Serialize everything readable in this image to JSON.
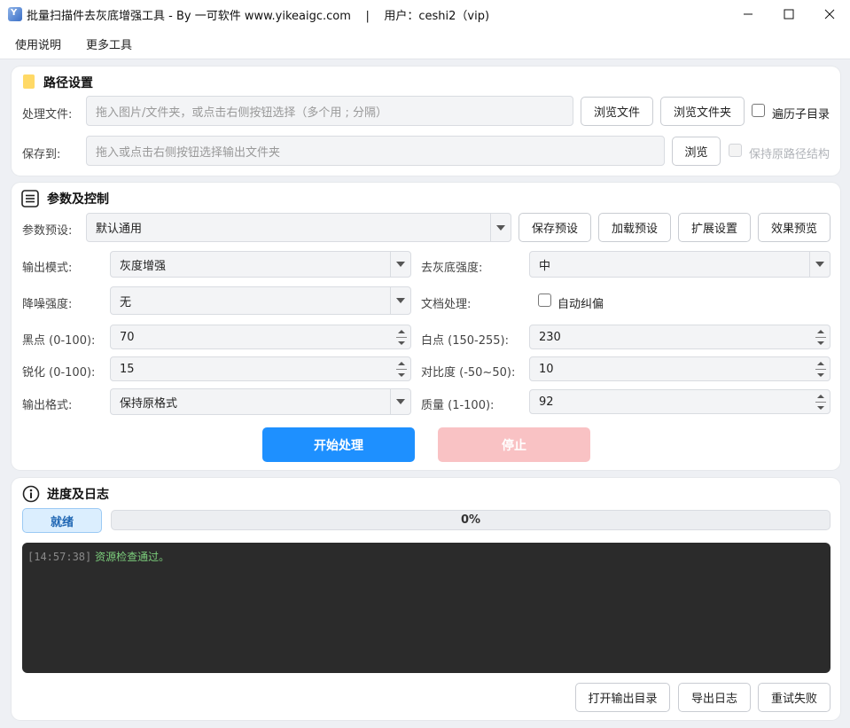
{
  "window": {
    "title": "批量扫描件去灰底增强工具 - By 一可软件 www.yikeaigc.com    |    用户：ceshi2（vip)",
    "icon_letter": "Y",
    "controls": {
      "minimize": "—",
      "maximize": "☐",
      "close": "✕"
    }
  },
  "menu": {
    "items": [
      "使用说明",
      "更多工具"
    ]
  },
  "path_settings": {
    "title": "路径设置",
    "input_label": "处理文件:",
    "input_placeholder": "拖入图片/文件夹，或点击右侧按钮选择（多个用 ; 分隔）",
    "browse_files": "浏览文件",
    "browse_folder": "浏览文件夹",
    "recurse_label": "遍历子目录",
    "recurse_checked": false,
    "save_label": "保存到:",
    "save_placeholder": "拖入或点击右侧按钮选择输出文件夹",
    "browse_save": "浏览",
    "keep_structure_label": "保持原路径结构",
    "keep_structure_checked": false,
    "keep_structure_enabled": false
  },
  "params": {
    "title": "参数及控制",
    "preset_label": "参数预设:",
    "preset_value": "默认通用",
    "save_preset": "保存预设",
    "load_preset": "加载预设",
    "extended_settings": "扩展设置",
    "preview": "效果预览",
    "output_mode_label": "输出模式:",
    "output_mode_value": "灰度增强",
    "degray_label": "去灰底强度:",
    "degray_value": "中",
    "denoise_label": "降噪强度:",
    "denoise_value": "无",
    "doc_label": "文档处理:",
    "auto_deskew_label": "自动纠偏",
    "auto_deskew_checked": false,
    "black_label": "黑点 (0-100):",
    "black_value": "70",
    "white_label": "白点 (150-255):",
    "white_value": "230",
    "sharpen_label": "锐化 (0-100):",
    "sharpen_value": "15",
    "contrast_label": "对比度 (-50~50):",
    "contrast_value": "10",
    "format_label": "输出格式:",
    "format_value": "保持原格式",
    "quality_label": "质量 (1-100):",
    "quality_value": "92",
    "start_button": "开始处理",
    "stop_button": "停止"
  },
  "progress": {
    "title": "进度及日志",
    "status": "就绪",
    "percent_text": "0%",
    "progress_fraction": 0.0,
    "log": [
      {
        "time": "[14:57:38]",
        "message": "资源检查通过。"
      }
    ],
    "open_output": "打开输出目录",
    "export_log": "导出日志",
    "retry_failed": "重试失败"
  },
  "colors": {
    "primary": "#1e90ff",
    "stop_disabled": "#f9c2c4",
    "status_bg": "#dbeefe",
    "status_text": "#1f66b3",
    "log_bg": "#2b2b2b",
    "log_time": "#8a8a8a",
    "log_ok": "#7ccf7c"
  }
}
